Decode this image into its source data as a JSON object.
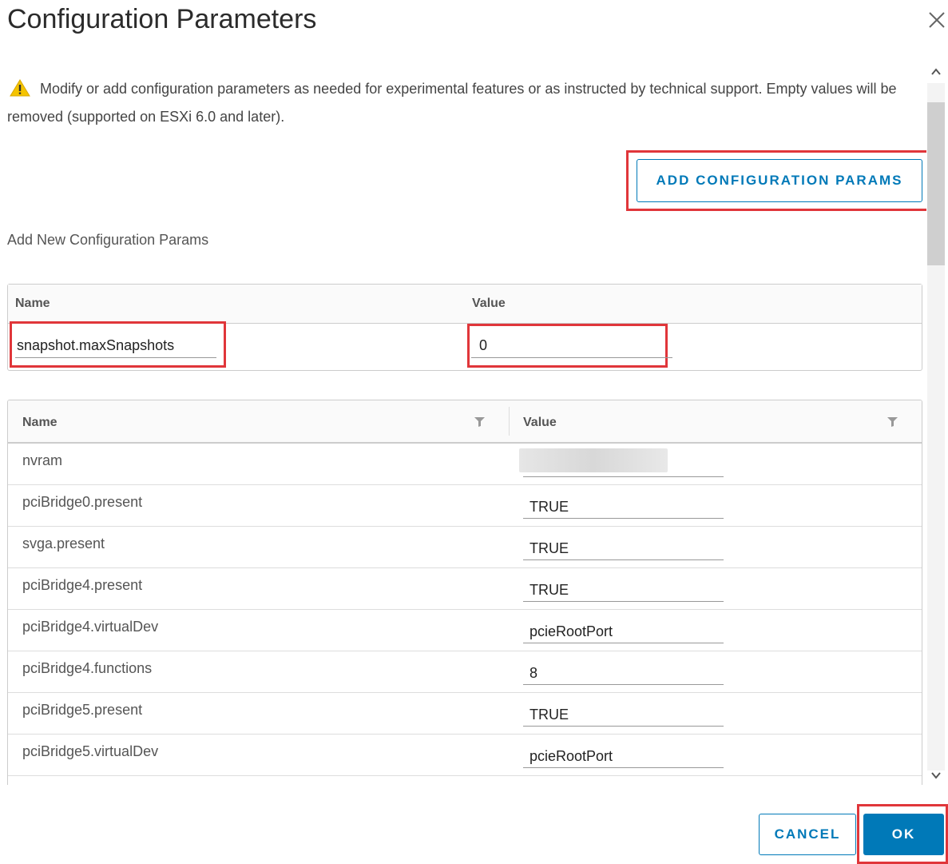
{
  "dialog": {
    "title": "Configuration Parameters"
  },
  "notice": {
    "text": "Modify or add configuration parameters as needed for experimental features or as instructed by technical support. Empty values will be removed (supported on ESXi 6.0 and later)."
  },
  "add_button": {
    "label": "ADD CONFIGURATION PARAMS"
  },
  "new_params": {
    "section_label": "Add New Configuration Params",
    "col_name": "Name",
    "col_value": "Value",
    "name_value": "snapshot.maxSnapshots",
    "value_value": "0"
  },
  "params_grid": {
    "col_name": "Name",
    "col_value": "Value",
    "rows": [
      {
        "name": "nvram",
        "value": ""
      },
      {
        "name": "pciBridge0.present",
        "value": "TRUE"
      },
      {
        "name": "svga.present",
        "value": "TRUE"
      },
      {
        "name": "pciBridge4.present",
        "value": "TRUE"
      },
      {
        "name": "pciBridge4.virtualDev",
        "value": "pcieRootPort"
      },
      {
        "name": "pciBridge4.functions",
        "value": "8"
      },
      {
        "name": "pciBridge5.present",
        "value": "TRUE"
      },
      {
        "name": "pciBridge5.virtualDev",
        "value": "pcieRootPort"
      }
    ]
  },
  "footer": {
    "cancel_label": "CANCEL",
    "ok_label": "OK"
  },
  "icons": {
    "warning": "warning-icon",
    "close": "close-icon",
    "filter": "filter-icon"
  },
  "colors": {
    "accent": "#0079b8",
    "highlight": "#e0363a",
    "warning": "#f5c400"
  }
}
